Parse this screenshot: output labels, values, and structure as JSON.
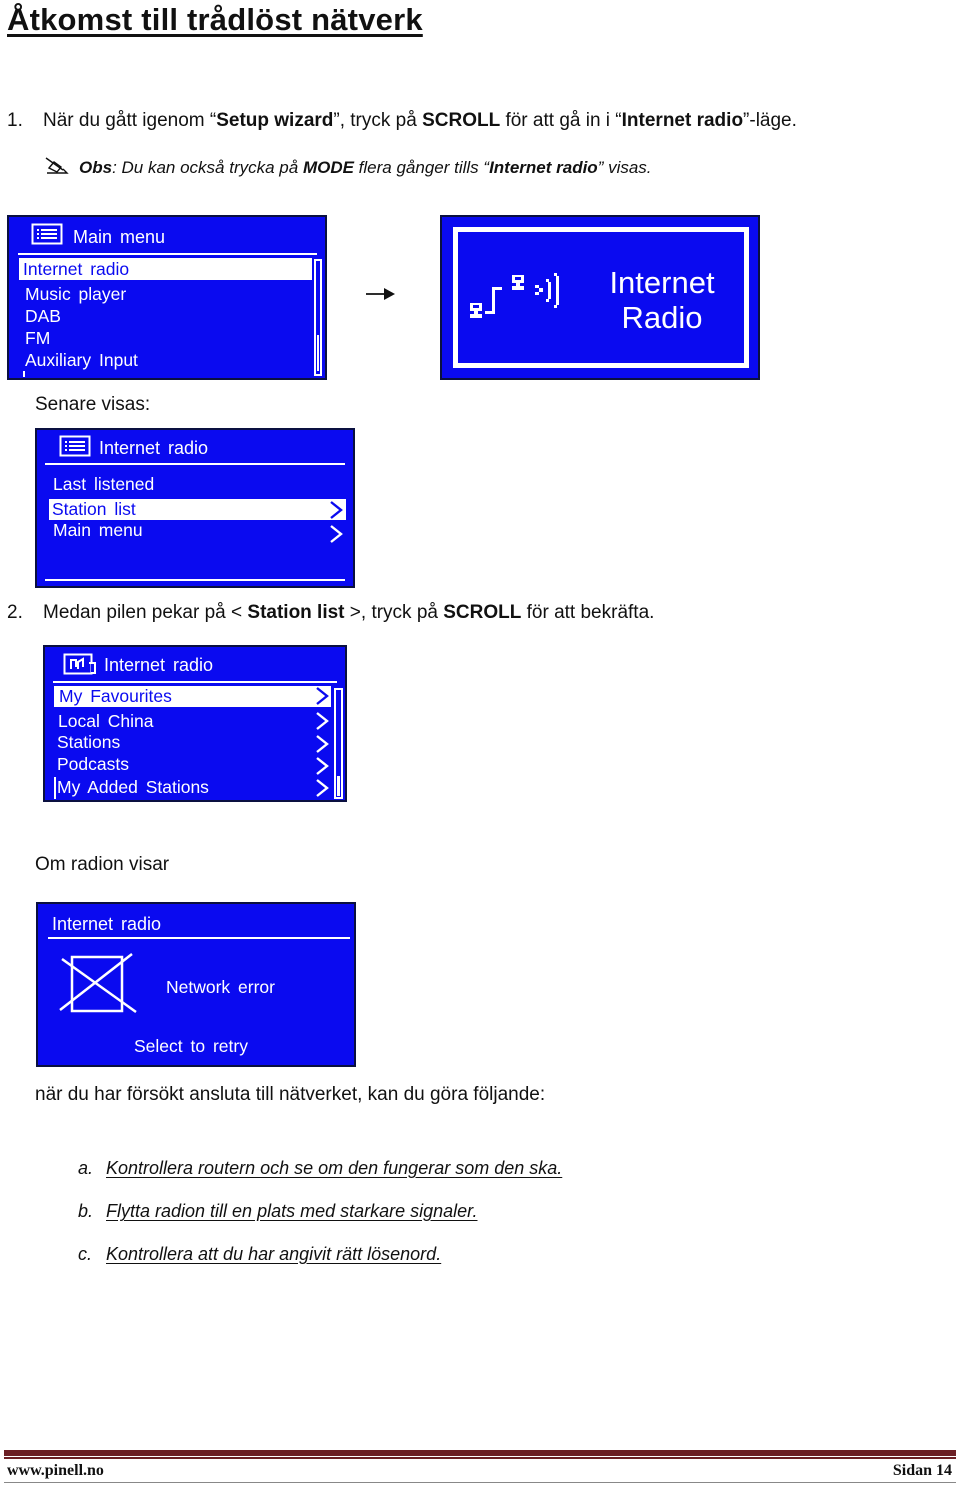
{
  "page": {
    "title": "Åtkomst till trådlöst nätverk"
  },
  "step1": {
    "number": "1.",
    "text_parts": [
      "När du gått igenom “",
      "Setup wizard",
      "”, tryck på ",
      "SCROLL",
      " för att gå in i “",
      "Internet radio",
      "”-läge."
    ]
  },
  "note1": {
    "icon": "pencil-note-icon",
    "label": "Obs",
    "text_parts": [
      ": Du kan också trycka på ",
      "MODE",
      " flera gånger tills “",
      "Internet radio",
      "” visas."
    ]
  },
  "screen_main_menu": {
    "icon": "menu-list-icon",
    "header": "Main menu",
    "items": [
      {
        "label": "Internet radio",
        "selected": true
      },
      {
        "label": "Music player",
        "selected": false
      },
      {
        "label": "DAB",
        "selected": false
      },
      {
        "label": "FM",
        "selected": false
      },
      {
        "label": "Auxiliary Input",
        "selected": false
      }
    ],
    "scroll_position": 0.8
  },
  "arrow": {
    "icon": "arrow-right-icon"
  },
  "screen_splash": {
    "icon": "network-radio-icon",
    "line1": "Internet",
    "line2": "Radio"
  },
  "later_label": "Senare visas:",
  "screen_internet_radio": {
    "icon": "menu-list-icon",
    "header": "Internet radio",
    "items": [
      {
        "label": "Last listened",
        "selected": false,
        "has_submenu": false
      },
      {
        "label": "Station list",
        "selected": true,
        "has_submenu": true
      },
      {
        "label": "Main menu",
        "selected": false,
        "has_submenu": true
      }
    ]
  },
  "step2": {
    "number": "2.",
    "text_parts": [
      "Medan pilen pekar på < ",
      "Station list",
      " >, tryck på ",
      "SCROLL",
      " för att bekräfta."
    ]
  },
  "screen_station_list": {
    "icon": "music-note-icon",
    "header": "Internet radio",
    "items": [
      {
        "label": "My Favourites",
        "selected": true,
        "has_submenu": true
      },
      {
        "label": "Local China",
        "selected": false,
        "has_submenu": true
      },
      {
        "label": "Stations",
        "selected": false,
        "has_submenu": true
      },
      {
        "label": "Podcasts",
        "selected": false,
        "has_submenu": true
      },
      {
        "label": "My Added Stations",
        "selected": false,
        "has_submenu": true
      }
    ],
    "scroll_position": 0.85
  },
  "if_radio_shows": "Om radion visar",
  "screen_network_error": {
    "header": "Internet radio",
    "icon": "crossed-box-icon",
    "message": "Network error",
    "action": "Select to retry"
  },
  "after_text": "när du har försökt ansluta till nätverket, kan du göra följande:",
  "troubleshooting": [
    {
      "label": "a.",
      "text": "Kontrollera routern och se om den fungerar som den ska."
    },
    {
      "label": "b.",
      "text": "Flytta radion till en plats med starkare signaler."
    },
    {
      "label": "c.",
      "text": "Kontrollera att du har angivit rätt lösenord."
    }
  ],
  "footer": {
    "website": "www.pinell.no",
    "page": "Sidan 14",
    "accent_color": "#6b1f24"
  },
  "colors": {
    "lcd_blue": "#0a0af0",
    "lcd_text": "#ffffff"
  }
}
